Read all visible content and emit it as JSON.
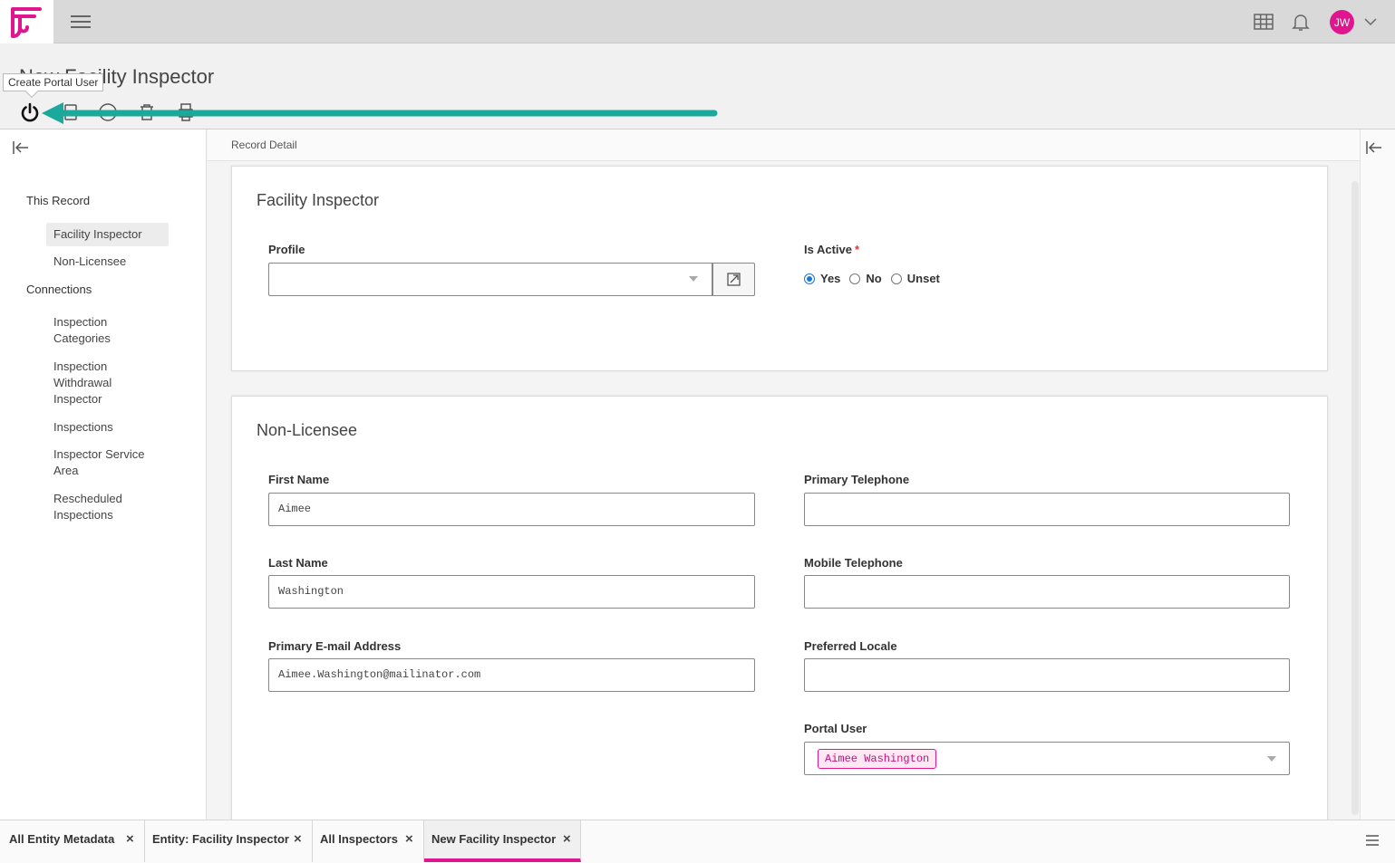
{
  "header": {
    "title": "New Facility Inspector",
    "tooltip": "Create Portal User",
    "avatar_initials": "JW"
  },
  "record_bar": {
    "label": "Record Detail"
  },
  "sidebar": {
    "this_record_heading": "This Record",
    "this_record_items": [
      {
        "label": "Facility Inspector"
      },
      {
        "label": "Non-Licensee"
      }
    ],
    "connections_heading": "Connections",
    "connection_items": [
      {
        "label": "Inspection Categories"
      },
      {
        "label": "Inspection Withdrawal Inspector"
      },
      {
        "label": "Inspections"
      },
      {
        "label": "Inspector Service Area"
      },
      {
        "label": "Rescheduled Inspections"
      }
    ]
  },
  "facility_card": {
    "title": "Facility Inspector",
    "profile_label": "Profile",
    "profile_value": "",
    "is_active_label": "Is Active",
    "required_mark": "*",
    "radio_options": [
      "Yes",
      "No",
      "Unset"
    ],
    "selected_option": "Yes"
  },
  "non_licensee_card": {
    "title": "Non-Licensee",
    "first_name_label": "First Name",
    "first_name_value": "Aimee",
    "last_name_label": "Last Name",
    "last_name_value": "Washington",
    "email_label": "Primary E-mail Address",
    "email_value": "Aimee.Washington@mailinator.com",
    "primary_phone_label": "Primary Telephone",
    "primary_phone_value": "",
    "mobile_phone_label": "Mobile Telephone",
    "mobile_phone_value": "",
    "locale_label": "Preferred Locale",
    "locale_value": "",
    "portal_user_label": "Portal User",
    "portal_user_value": "Aimee Washington"
  },
  "tabs": [
    {
      "label": "All Entity Metadata"
    },
    {
      "label": "Entity: Facility Inspector"
    },
    {
      "label": "All Inspectors"
    },
    {
      "label": "New Facility Inspector"
    }
  ],
  "tab_close_glyph": "×",
  "colors": {
    "brand": "#e0168f",
    "arrow": "#1aa99a",
    "radio_selected": "#1976d2"
  }
}
